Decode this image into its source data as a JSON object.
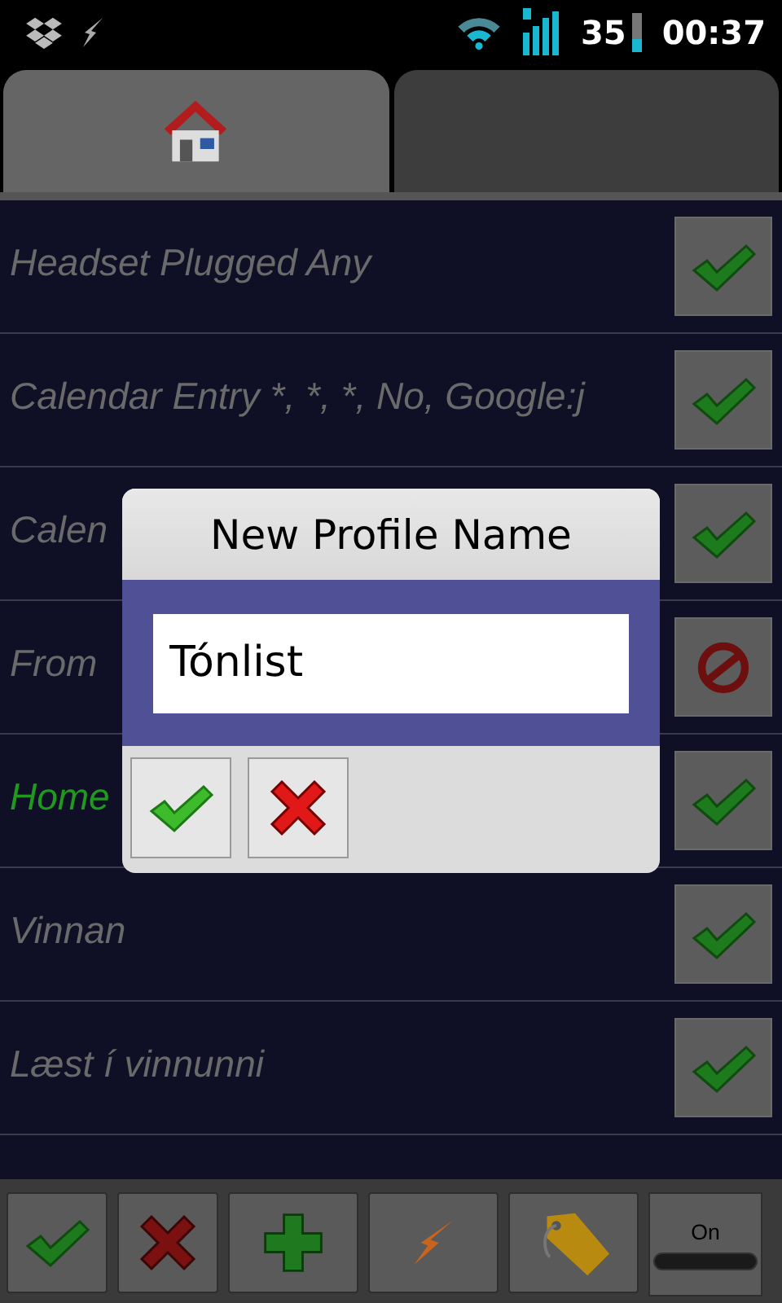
{
  "status_bar": {
    "battery": "35",
    "time": "00:37"
  },
  "tabs": [
    {
      "selected": true
    },
    {
      "selected": false
    }
  ],
  "rules": [
    {
      "label": "Headset Plugged Any",
      "active": false,
      "enabled": true
    },
    {
      "label": "Calendar Entry *, *, *, No, Google:j",
      "active": false,
      "enabled": true
    },
    {
      "label": "Calen",
      "active": false,
      "enabled": true
    },
    {
      "label": "From",
      "active": false,
      "enabled": false
    },
    {
      "label": "Home",
      "active": true,
      "enabled": true
    },
    {
      "label": "Vinnan",
      "active": false,
      "enabled": true
    },
    {
      "label": "Læst í vinnunni",
      "active": false,
      "enabled": true
    }
  ],
  "dialog": {
    "title": "New Profile Name",
    "value": "Tónlist",
    "buttons": [
      {
        "kind": "accept"
      },
      {
        "kind": "cancel"
      }
    ]
  },
  "toolbar": [
    {
      "kind": "accept"
    },
    {
      "kind": "cancel"
    },
    {
      "kind": "add"
    },
    {
      "kind": "bolt"
    },
    {
      "kind": "tag"
    },
    {
      "kind": "toggle",
      "label": "On",
      "on": true
    }
  ]
}
